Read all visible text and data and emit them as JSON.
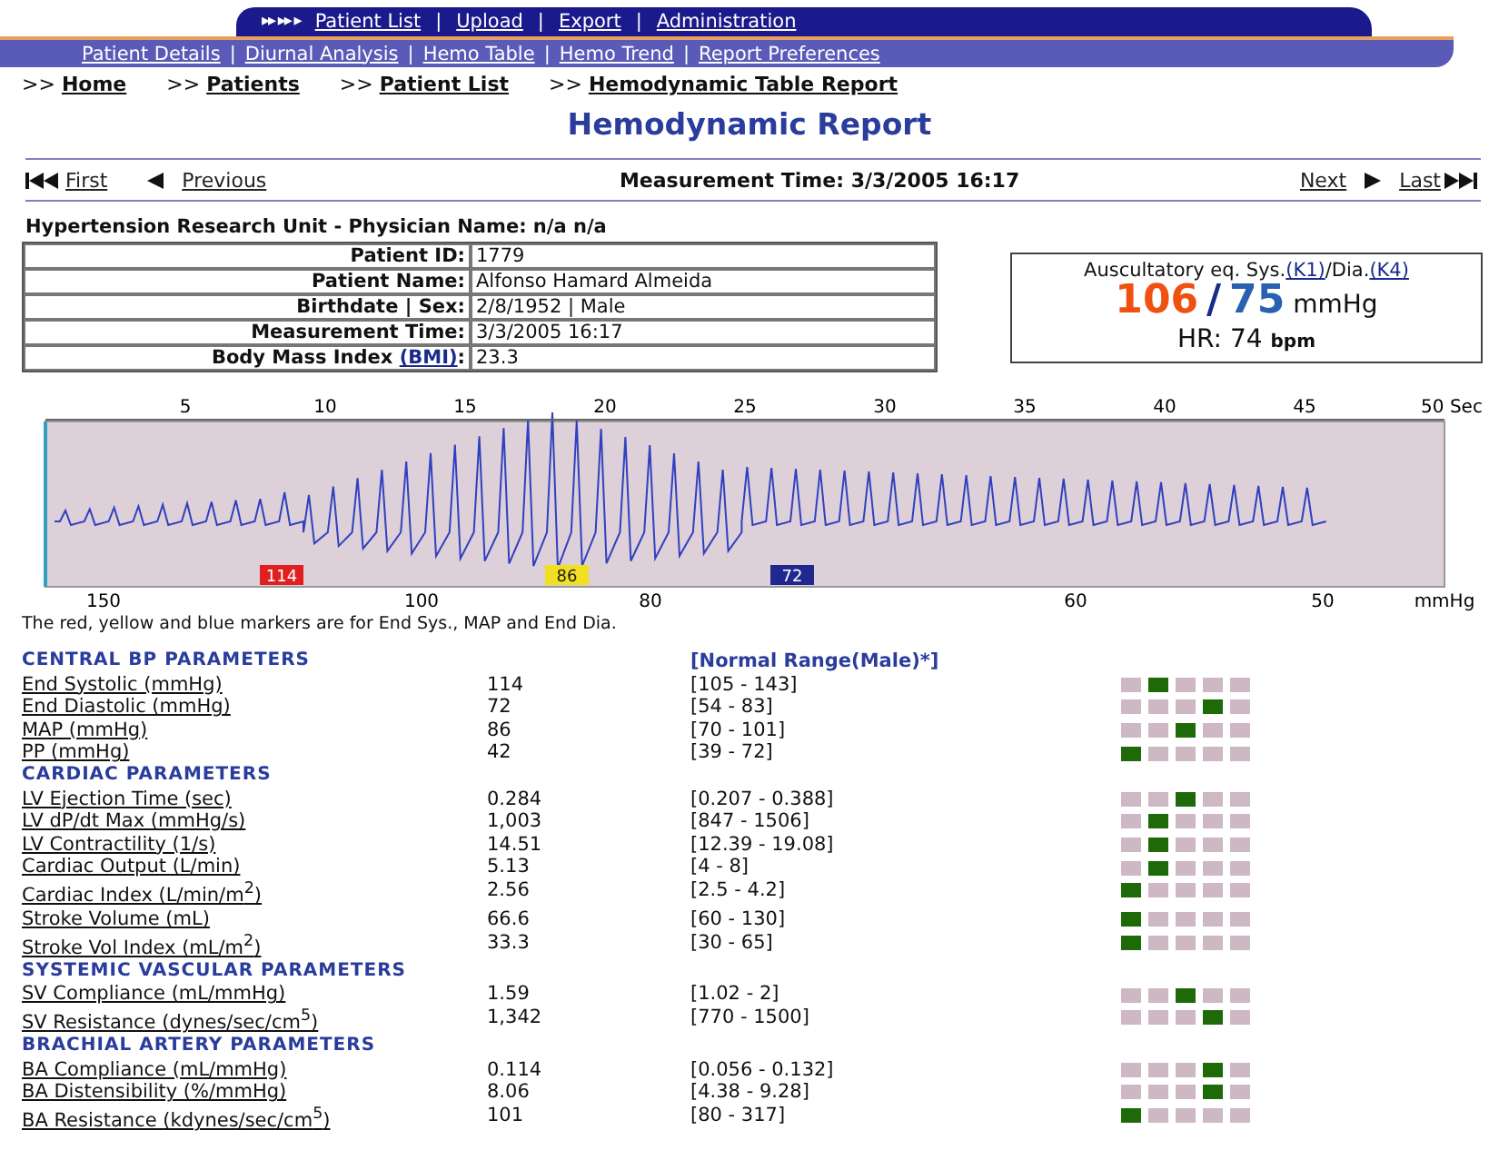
{
  "top_nav": {
    "arrows": "▸▸ ▸▸ ▸",
    "links": [
      "Patient List",
      "Upload",
      "Export",
      "Administration"
    ],
    "separator": "|"
  },
  "sub_nav": {
    "separator": "|",
    "links": [
      "Patient Details",
      "Diurnal Analysis",
      "Hemo Table",
      "Hemo Trend",
      "Report Preferences"
    ]
  },
  "breadcrumbs": [
    {
      "prefix": ">>",
      "label": "Home"
    },
    {
      "prefix": ">>",
      "label": "Patients"
    },
    {
      "prefix": ">>",
      "label": "Patient List"
    },
    {
      "prefix": ">>",
      "label": "Hemodynamic Table Report"
    }
  ],
  "title": "Hemodynamic Report",
  "pager": {
    "first": "First",
    "previous": "Previous",
    "measurement": "Measurement Time: 3/3/2005 16:17",
    "next": "Next",
    "last": "Last"
  },
  "unit_line": "Hypertension Research Unit - Physician Name: n/a n/a",
  "patient": [
    {
      "label": "Patient ID:",
      "value": "1779"
    },
    {
      "label": "Patient Name:",
      "value": "Alfonso Hamard Almeida"
    },
    {
      "label": "Birthdate | Sex:",
      "value": "2/8/1952 | Male"
    },
    {
      "label": "Measurement Time:",
      "value": "3/3/2005 16:17"
    },
    {
      "label": "Body Mass Index ",
      "link": "(BMI)",
      "suffix": ":",
      "value": "23.3"
    }
  ],
  "bp_box": {
    "caption": "Auscultatory eq. Sys.",
    "k1": "(K1)",
    "sep": "/Dia.",
    "k4": "(K4)",
    "sys": "106",
    "slash": "/",
    "dia": "75",
    "unit": "mmHg",
    "hr_label": "HR:",
    "hr": "74",
    "hr_unit": "bpm"
  },
  "waveform": {
    "time_ticks": [
      "5",
      "10",
      "15",
      "20",
      "25",
      "30",
      "35",
      "40",
      "45",
      "50 Sec"
    ],
    "pressure_ticks": [
      "150",
      "100",
      "80",
      "60",
      "50",
      "mmHg"
    ],
    "markers": [
      {
        "label": "114",
        "color": "#e02020"
      },
      {
        "label": "86",
        "color": "#f0e020"
      },
      {
        "label": "72",
        "color": "#202890"
      }
    ]
  },
  "note": "The red, yellow and blue markers are for End Sys., MAP and End Dia.",
  "parameters": [
    {
      "kind": "section",
      "label": "CENTRAL BP PARAMETERS",
      "range_heading": "[Normal Range(Male)*]"
    },
    {
      "kind": "param",
      "name": "End Systolic (mmHg)",
      "value": "114",
      "range": "[105 - 143]",
      "marker": [
        false,
        true,
        false,
        false,
        false
      ]
    },
    {
      "kind": "param",
      "name": "End Diastolic (mmHg)",
      "value": "72",
      "range": "[54 - 83]",
      "marker": [
        false,
        false,
        false,
        true,
        false
      ]
    },
    {
      "kind": "param",
      "name": "MAP (mmHg)",
      "value": "86",
      "range": "[70 - 101]",
      "marker": [
        false,
        false,
        true,
        false,
        false
      ]
    },
    {
      "kind": "param",
      "name": "PP (mmHg)",
      "value": "42",
      "range": "[39 - 72]",
      "marker": [
        true,
        false,
        false,
        false,
        false
      ]
    },
    {
      "kind": "section",
      "label": "CARDIAC PARAMETERS"
    },
    {
      "kind": "param",
      "name": "LV Ejection Time (sec)",
      "value": "0.284",
      "range": "[0.207 - 0.388]",
      "marker": [
        false,
        false,
        true,
        false,
        false
      ]
    },
    {
      "kind": "param",
      "name": "LV dP/dt Max (mmHg/s)",
      "value": "1,003",
      "range": "[847 - 1506]",
      "marker": [
        false,
        true,
        false,
        false,
        false
      ]
    },
    {
      "kind": "param",
      "name": "LV Contractility (1/s)",
      "value": "14.51",
      "range": "[12.39 - 19.08]",
      "marker": [
        false,
        true,
        false,
        false,
        false
      ]
    },
    {
      "kind": "param",
      "name": "Cardiac Output (L/min)",
      "value": "5.13",
      "range": "[4 - 8]",
      "marker": [
        false,
        true,
        false,
        false,
        false
      ]
    },
    {
      "kind": "param",
      "name": "Cardiac Index (L/min/m$^{2}$)",
      "value": "2.56",
      "range": "[2.5 - 4.2]",
      "marker": [
        true,
        false,
        false,
        false,
        false
      ]
    },
    {
      "kind": "param",
      "name": "Stroke Volume (mL)",
      "value": "66.6",
      "range": "[60 - 130]",
      "marker": [
        true,
        false,
        false,
        false,
        false
      ]
    },
    {
      "kind": "param",
      "name": "Stroke Vol Index (mL/m$^{2}$)",
      "value": "33.3",
      "range": "[30 - 65]",
      "marker": [
        true,
        false,
        false,
        false,
        false
      ]
    },
    {
      "kind": "section",
      "label": "SYSTEMIC VASCULAR PARAMETERS"
    },
    {
      "kind": "param",
      "name": "SV Compliance (mL/mmHg)",
      "value": "1.59",
      "range": "[1.02 - 2]",
      "marker": [
        false,
        false,
        true,
        false,
        false
      ]
    },
    {
      "kind": "param",
      "name": "SV Resistance (dynes/sec/cm$^{5}$)",
      "value": "1,342",
      "range": "[770 - 1500]",
      "marker": [
        false,
        false,
        false,
        true,
        false
      ]
    },
    {
      "kind": "section",
      "label": "BRACHIAL ARTERY PARAMETERS"
    },
    {
      "kind": "param",
      "name": "BA Compliance (mL/mmHg)",
      "value": "0.114",
      "range": "[0.056 - 0.132]",
      "marker": [
        false,
        false,
        false,
        true,
        false
      ]
    },
    {
      "kind": "param",
      "name": "BA Distensibility (%/mmHg)",
      "value": "8.06",
      "range": "[4.38 - 9.28]",
      "marker": [
        false,
        false,
        false,
        true,
        false
      ]
    },
    {
      "kind": "param",
      "name": "BA Resistance (kdynes/sec/cm$^{5}$)",
      "value": "101",
      "range": "[80 - 317]",
      "marker": [
        true,
        false,
        false,
        false,
        false
      ]
    }
  ]
}
